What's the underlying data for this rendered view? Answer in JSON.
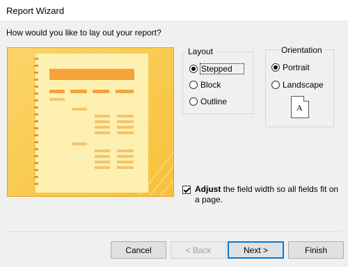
{
  "window": {
    "title": "Report Wizard"
  },
  "prompt": "How would you like to lay out your report?",
  "layout": {
    "title": "Layout",
    "options": [
      "Stepped",
      "Block",
      "Outline"
    ],
    "selected": "Stepped"
  },
  "orientation": {
    "title": "Orientation",
    "options": [
      "Portrait",
      "Landscape"
    ],
    "selected": "Portrait",
    "icon_letter": "A"
  },
  "adjust": {
    "checked": true,
    "label_bold": "Adjust",
    "label_rest": " the field width so all fields fit on a page."
  },
  "buttons": {
    "cancel": "Cancel",
    "back": "< Back",
    "next": "Next >",
    "finish": "Finish"
  },
  "colors": {
    "preview_bg": "#f9c84a",
    "preview_accent": "#f3a33a"
  }
}
